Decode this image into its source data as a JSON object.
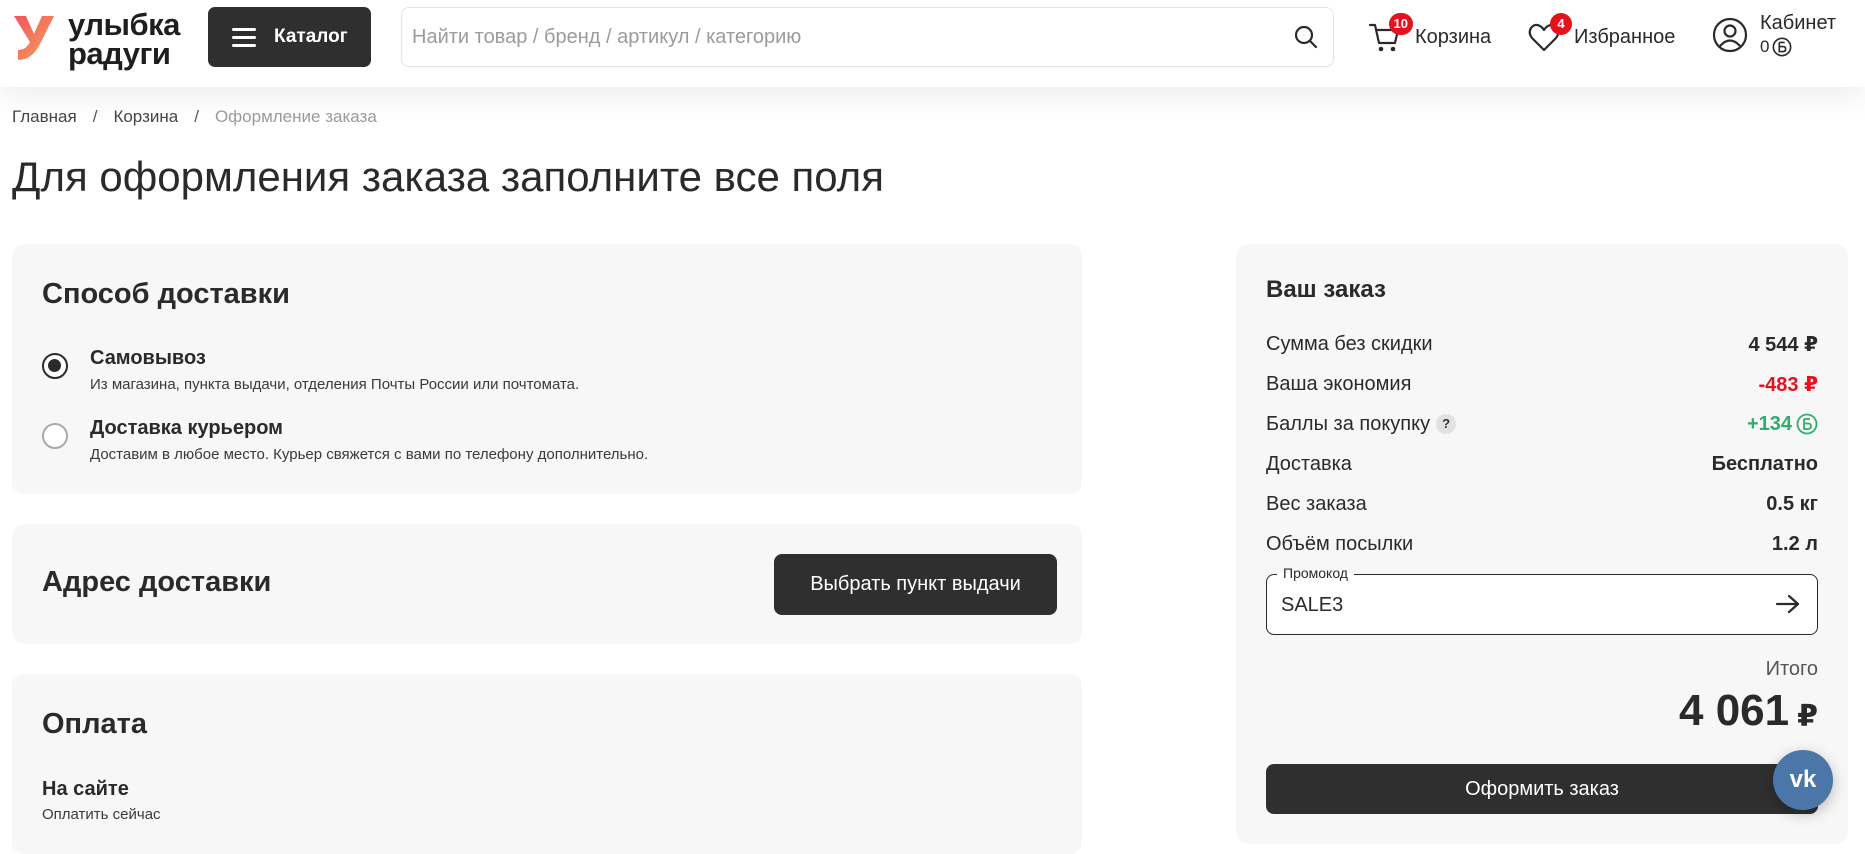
{
  "header": {
    "logo_line1": "улыбка",
    "logo_line2": "радуги",
    "catalog_label": "Каталог",
    "search_placeholder": "Найти товар / бренд / артикул / категорию",
    "cart_label": "Корзина",
    "cart_count": "10",
    "favorites_label": "Избранное",
    "favorites_count": "4",
    "cabinet_label": "Кабинет",
    "cabinet_points": "0"
  },
  "breadcrumb": {
    "items": [
      "Главная",
      "Корзина",
      "Оформление заказа"
    ],
    "separator": "/"
  },
  "page_title": "Для оформления заказа заполните все поля",
  "delivery": {
    "title": "Способ доставки",
    "options": [
      {
        "label": "Самовывоз",
        "description": "Из магазина, пункта выдачи, отделения Почты России или почтомата.",
        "selected": true
      },
      {
        "label": "Доставка курьером",
        "description": "Доставим в любое место. Курьер свяжется с вами по телефону дополнительно.",
        "selected": false
      }
    ]
  },
  "address": {
    "title": "Адрес доставки",
    "button": "Выбрать пункт выдачи"
  },
  "payment": {
    "title": "Оплата",
    "option_label": "На сайте",
    "option_description": "Оплатить сейчас"
  },
  "summary": {
    "title": "Ваш заказ",
    "rows": [
      {
        "label": "Сумма без скидки",
        "value": "4 544 ₽"
      },
      {
        "label": "Ваша экономия",
        "value": "-483 ₽"
      },
      {
        "label": "Баллы за покупку",
        "value": "+134",
        "help": "?"
      },
      {
        "label": "Доставка",
        "value": "Бесплатно"
      },
      {
        "label": "Вес заказа",
        "value": "0.5 кг"
      },
      {
        "label": "Объём посылки",
        "value": "1.2 л"
      }
    ],
    "promo_legend": "Промокод",
    "promo_value": "SALE3",
    "total_label": "Итого",
    "total_value": "4 061",
    "total_currency": "₽",
    "checkout_button": "Оформить заказ"
  },
  "colors": {
    "accent_dark": "#2f2f2f",
    "badge_red": "#e5121e",
    "savings_red": "#e5121e",
    "points_green": "#2eae6a",
    "vk_blue": "#4a76a8"
  },
  "widgets": {
    "vk_label": "vk"
  }
}
